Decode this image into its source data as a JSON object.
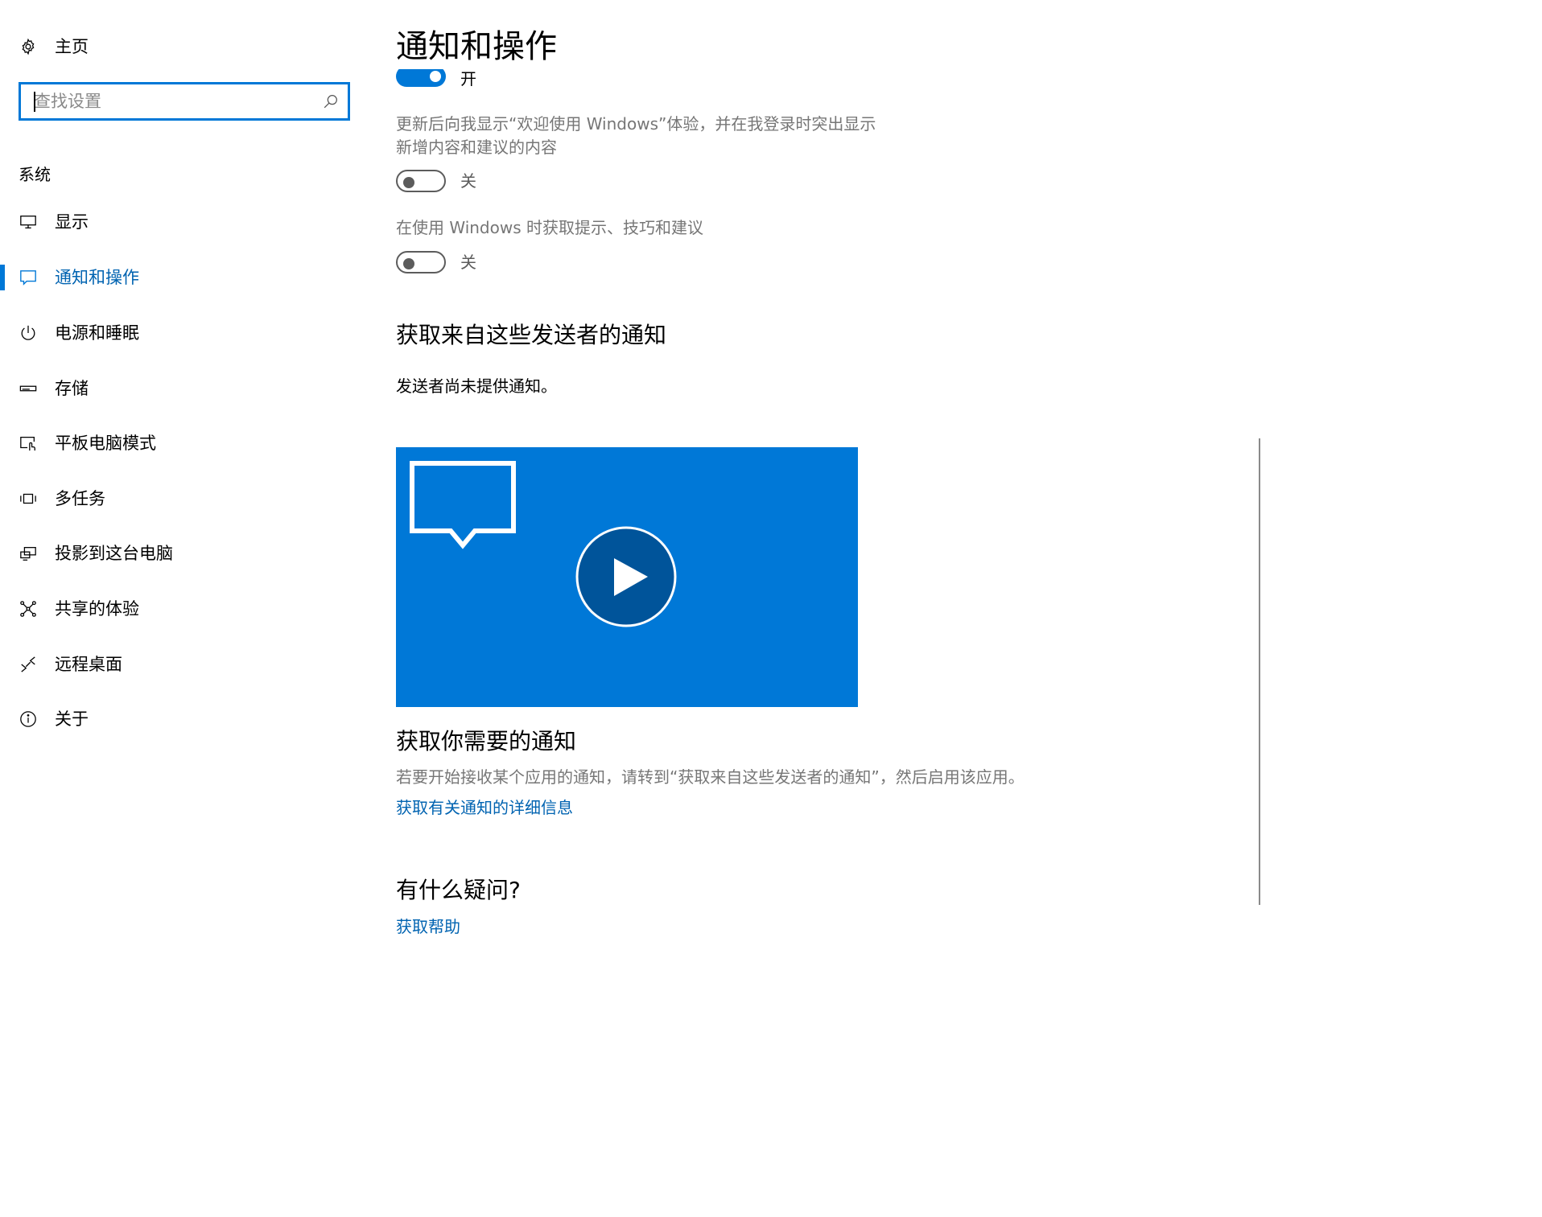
{
  "sidebar": {
    "home_label": "主页",
    "search_placeholder": "查找设置",
    "section_label": "系统",
    "items": [
      {
        "label": "显示",
        "icon": "monitor-icon"
      },
      {
        "label": "通知和操作",
        "icon": "message-icon",
        "active": true
      },
      {
        "label": "电源和睡眠",
        "icon": "power-icon"
      },
      {
        "label": "存储",
        "icon": "storage-icon"
      },
      {
        "label": "平板电脑模式",
        "icon": "tablet-mode-icon"
      },
      {
        "label": "多任务",
        "icon": "multitasking-icon"
      },
      {
        "label": "投影到这台电脑",
        "icon": "projection-icon"
      },
      {
        "label": "共享的体验",
        "icon": "shared-experience-icon"
      },
      {
        "label": "远程桌面",
        "icon": "remote-desktop-icon"
      },
      {
        "label": "关于",
        "icon": "info-icon"
      }
    ]
  },
  "main": {
    "title": "通知和操作",
    "toggle_top": {
      "state_label": "开",
      "on": true
    },
    "welcome_setting": {
      "description_line1": "更新后向我显示“欢迎使用 Windows”体验，并在我登录时突出显示",
      "description_line2": "新增内容和建议的内容",
      "state_label": "关",
      "on": false
    },
    "tips_setting": {
      "description": "在使用 Windows 时获取提示、技巧和建议",
      "state_label": "关",
      "on": false
    },
    "senders_section": {
      "title": "获取来自这些发送者的通知",
      "empty_text": "发送者尚未提供通知。"
    },
    "video": {
      "icon_bubble": "message-bubble-icon",
      "icon_play": "play-icon",
      "background": "#0078d7"
    },
    "need_section": {
      "title": "获取你需要的通知",
      "description": "若要开始接收某个应用的通知，请转到“获取来自这些发送者的通知”，然后启用该应用。",
      "link": "获取有关通知的详细信息"
    },
    "questions_section": {
      "title": "有什么疑问?",
      "link": "获取帮助"
    }
  },
  "colors": {
    "accent": "#0078d7",
    "link": "#0063b1",
    "muted_text": "#767676"
  }
}
